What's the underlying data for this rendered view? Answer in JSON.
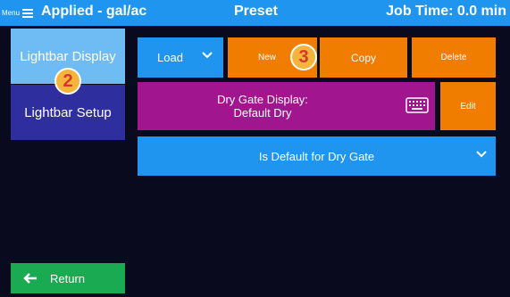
{
  "topbar": {
    "menu_label": "Menu",
    "applied": "Applied - gal/ac",
    "preset": "Preset",
    "job_time": "Job Time: 0.0 min"
  },
  "nav": {
    "lightbar_display": "Lightbar Display",
    "lightbar_setup": "Lightbar Setup",
    "return": "Return"
  },
  "badges": {
    "step2": "2",
    "step3": "3"
  },
  "toolbar": {
    "load": "Load",
    "new": "New",
    "copy": "Copy",
    "delete": "Delete"
  },
  "gate": {
    "line1": "Dry Gate Display:",
    "line2": "Default Dry",
    "edit": "Edit"
  },
  "default_dropdown": {
    "selected": "Is Default for Dry Gate"
  },
  "icons": {
    "menu": "hamburger-icon",
    "load_chevron": "chevron-down-icon",
    "keyboard": "keyboard-icon",
    "dropdown_chevron": "chevron-down-icon",
    "return_arrow": "arrow-left-icon"
  },
  "colors": {
    "background": "#0a0a1e",
    "accent_blue": "#1f95f0",
    "orange": "#f07d00",
    "purple": "#a1168f",
    "green": "#1aaa52",
    "selected_nav": "#6fbbf3",
    "nav_dark_blue": "#2e2e9e",
    "badge": "#f5b53d"
  }
}
